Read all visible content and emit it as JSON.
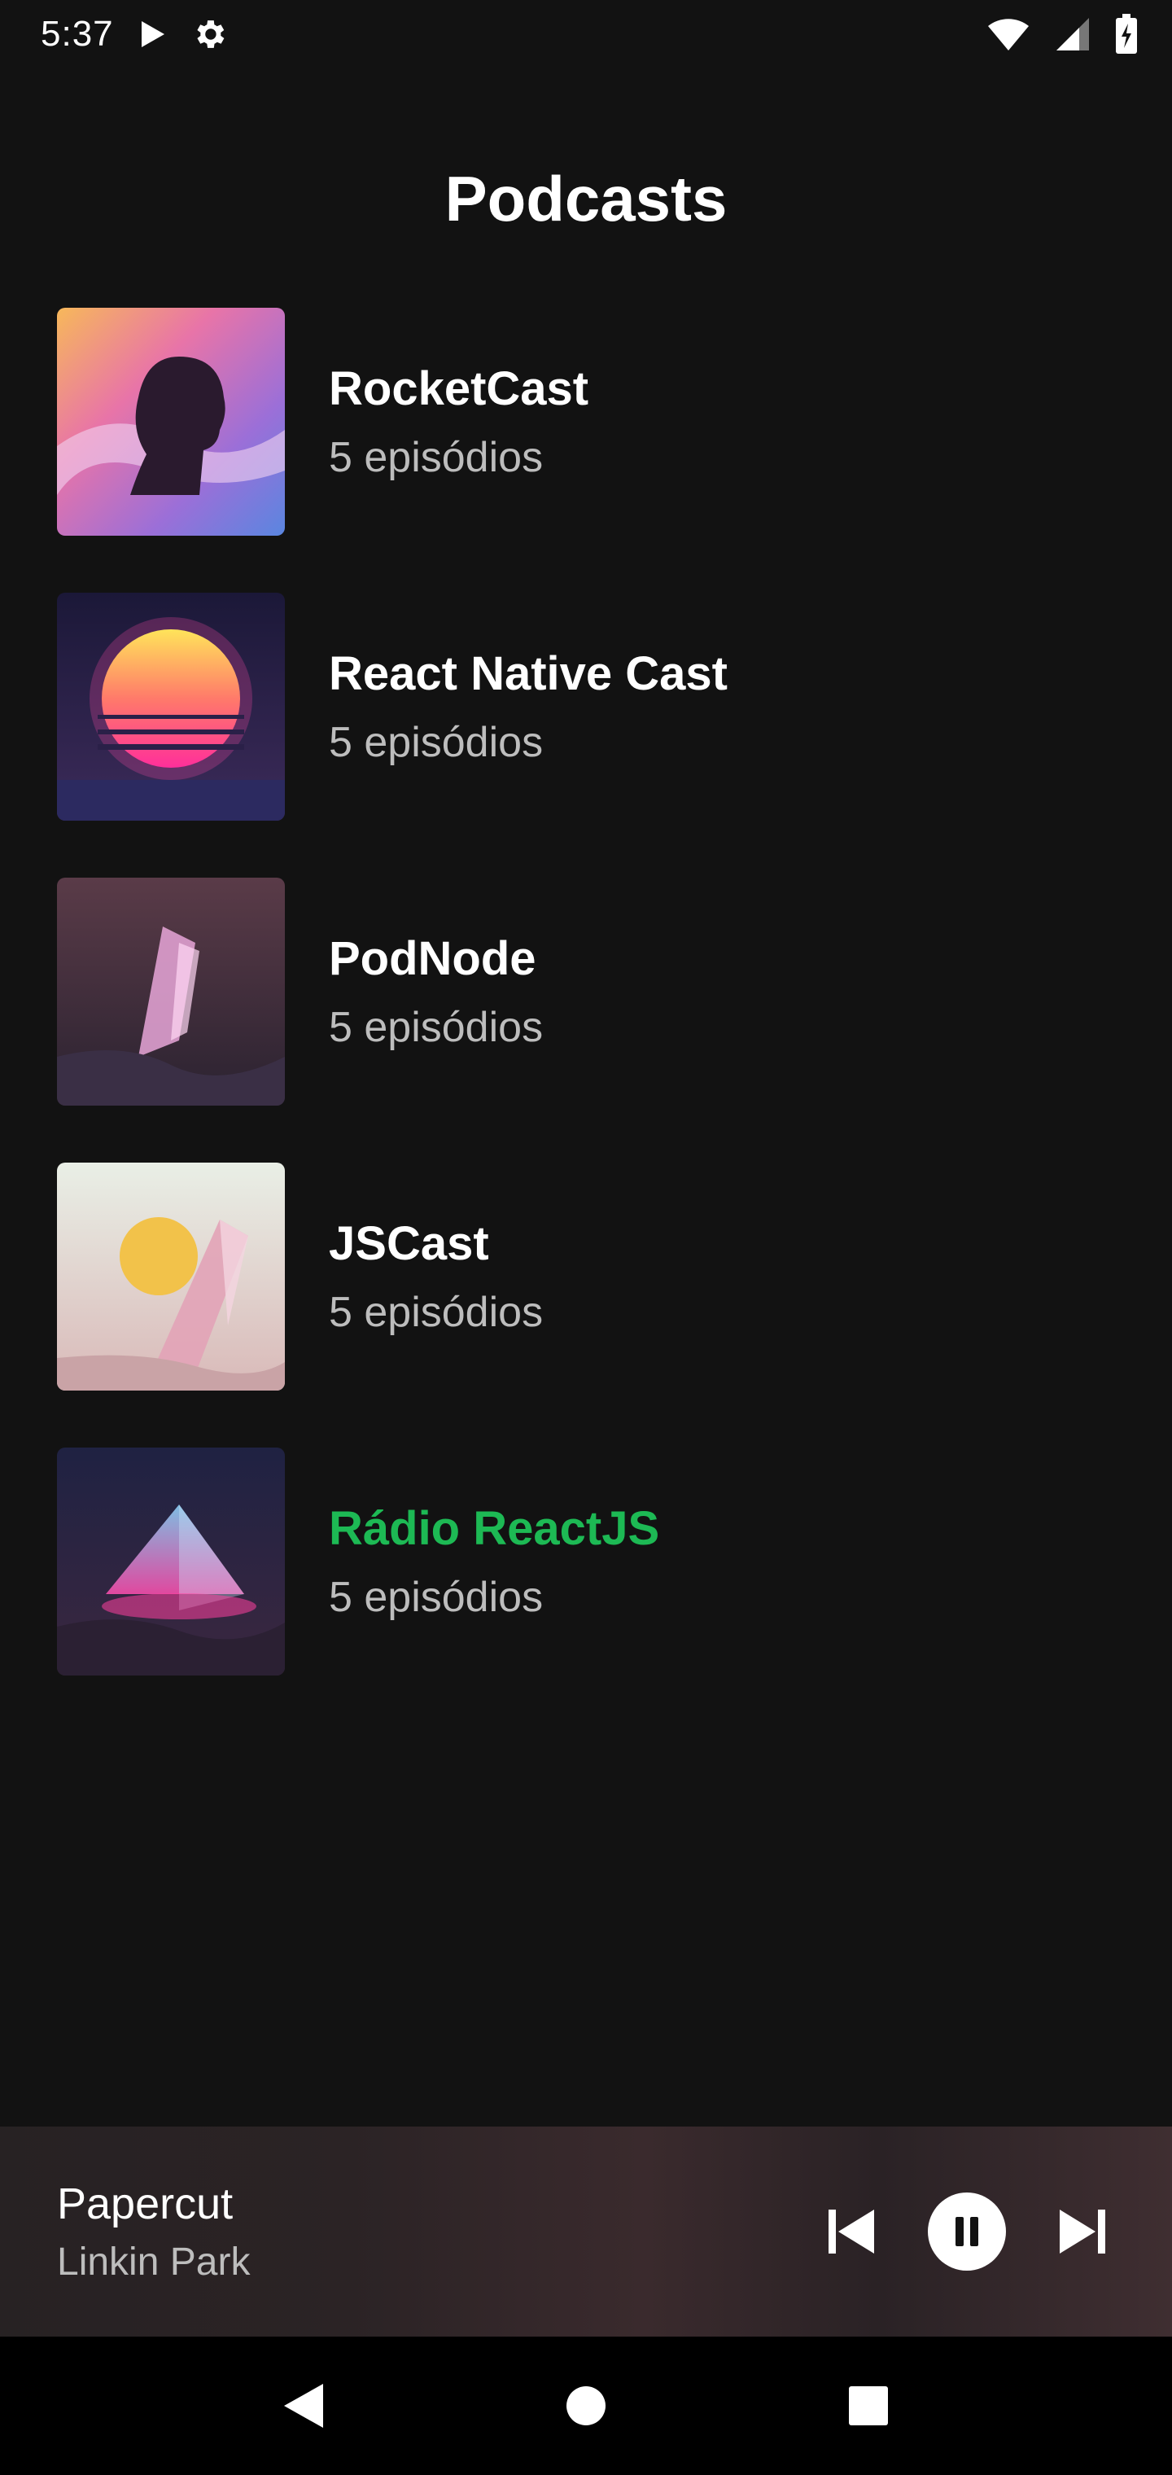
{
  "status_bar": {
    "time": "5:37",
    "icons": [
      "play-icon",
      "gear-icon",
      "wifi-icon",
      "signal-icon",
      "battery-charging-icon"
    ]
  },
  "page": {
    "title": "Podcasts"
  },
  "podcasts": [
    {
      "title": "RocketCast",
      "episodes": "5 episódios",
      "active": false
    },
    {
      "title": "React Native Cast",
      "episodes": "5 episódios",
      "active": false
    },
    {
      "title": "PodNode",
      "episodes": "5 episódios",
      "active": false
    },
    {
      "title": "JSCast",
      "episodes": "5 episódios",
      "active": false
    },
    {
      "title": "Rádio ReactJS",
      "episodes": "5 episódios",
      "active": true
    }
  ],
  "player": {
    "track_title": "Papercut",
    "artist": "Linkin Park",
    "controls": [
      "skip-previous-icon",
      "pause-icon",
      "skip-next-icon"
    ]
  },
  "navigation": [
    "back-icon",
    "home-icon",
    "recents-icon"
  ],
  "colors": {
    "background": "#121212",
    "accent": "#1db954",
    "text_primary": "#ffffff",
    "text_secondary": "#bdbdbd"
  }
}
